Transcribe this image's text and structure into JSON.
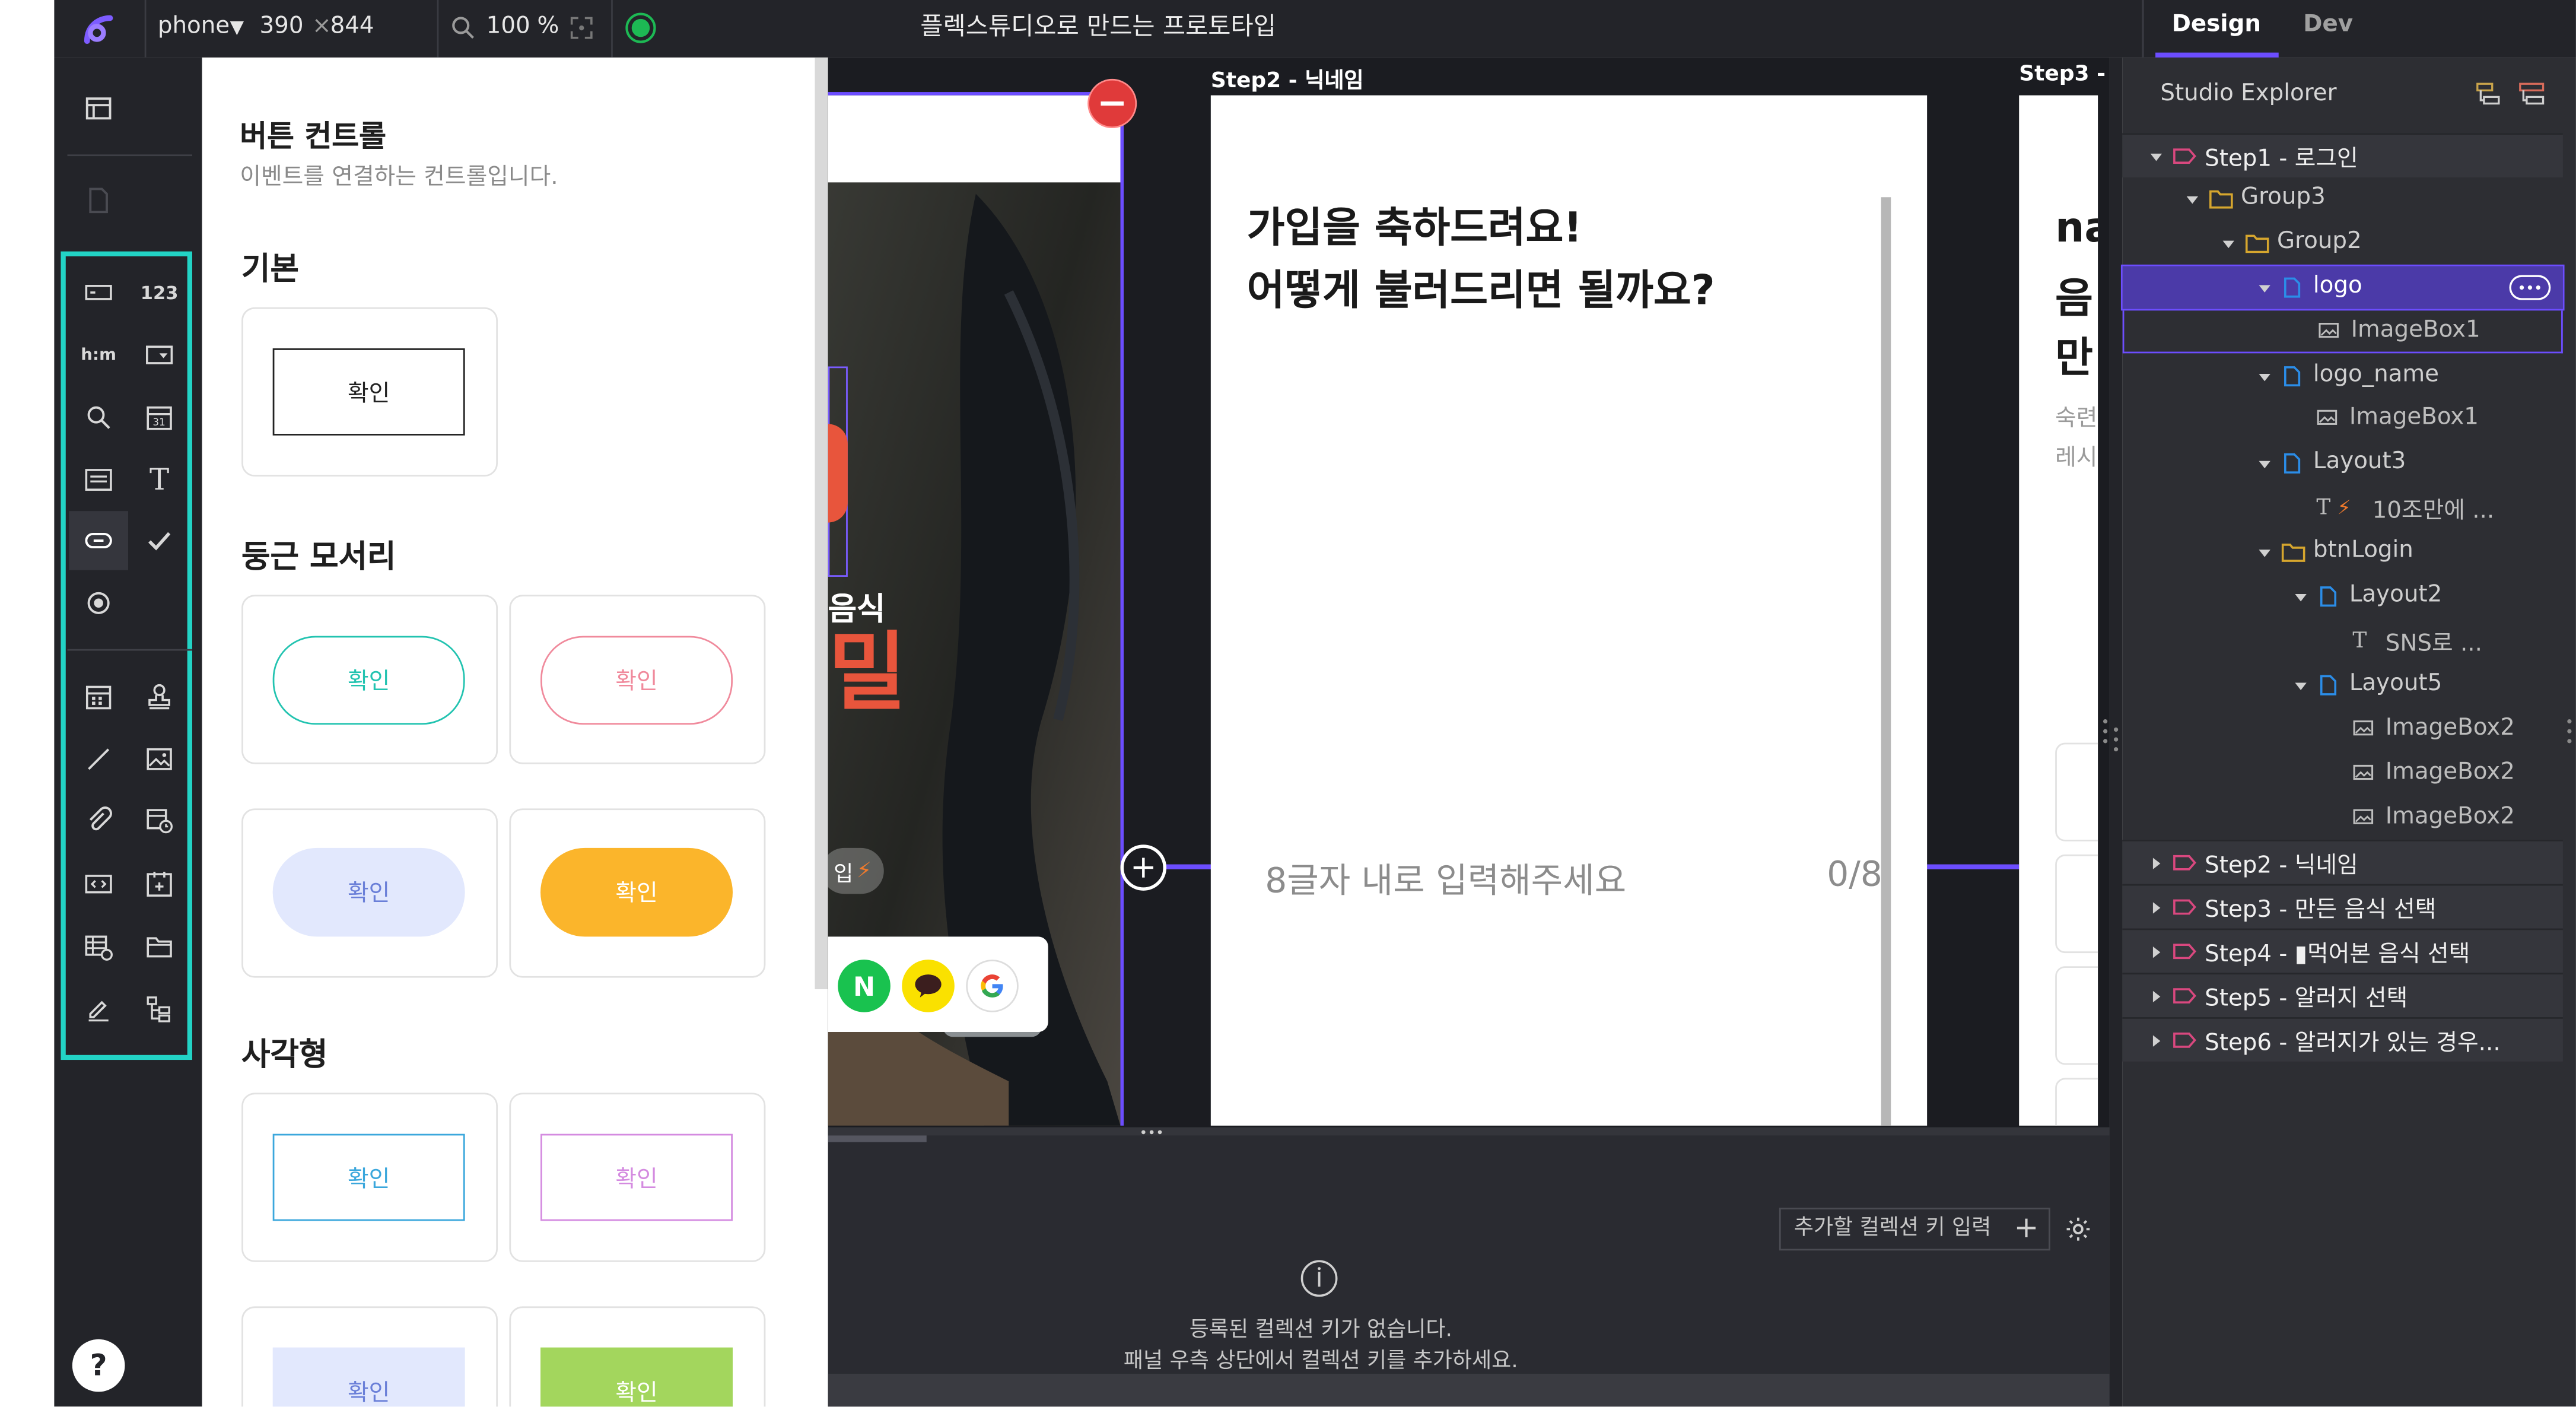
{
  "app": {
    "title": "플렉스튜디오로 만드는 프로토타입",
    "device": "phone",
    "width": "390",
    "times": "×",
    "height": "844",
    "zoom": "100",
    "zoom_unit": "%"
  },
  "right_tabs": {
    "design": "Design",
    "dev": "Dev"
  },
  "panel": {
    "title": "버튼 컨트롤",
    "subtitle": "이벤트를 연결하는 컨트롤입니다.",
    "sections": {
      "basic": "기본",
      "rounded": "둥근 모서리",
      "square": "사각형"
    },
    "button_label": "확인"
  },
  "canvas": {
    "step2_label": "Step2 - 닉네임",
    "step3_label": "Step3 -",
    "step2_heading_1": "가입을 축하드려요!",
    "step2_heading_2": "어떻게 불러드리면 될까요?",
    "step2_placeholder": "8글자 내로 입력해주세요",
    "step2_counter": "0/8",
    "step1_food_text": "음식",
    "step1_big_text": "밀",
    "step1_pill_text": "입",
    "step3_frag_1": "na",
    "step3_frag_2": "음",
    "step3_frag_3": "만",
    "step3_frag_4": "숙련",
    "step3_frag_5": "레시",
    "social": {
      "naver": "N"
    }
  },
  "collection": {
    "key_input_placeholder": "추가할 컬렉션 키 입력",
    "plus": "+",
    "empty_title": "등록된 컬렉션 키가 없습니다.",
    "empty_desc": "패널 우측 상단에서 컬렉션 키를 추가하세요."
  },
  "explorer": {
    "title": "Studio Explorer",
    "tree": [
      {
        "label": "Step1 - 로그인",
        "type": "screen",
        "depth": 0,
        "expanded": true
      },
      {
        "label": "Group3",
        "type": "folder",
        "depth": 1,
        "expanded": true
      },
      {
        "label": "Group2",
        "type": "folder",
        "depth": 2,
        "expanded": true
      },
      {
        "label": "logo",
        "type": "layout",
        "depth": 3,
        "expanded": true,
        "selected": true
      },
      {
        "label": "ImageBox1",
        "type": "image",
        "depth": 4,
        "in_selection": true
      },
      {
        "label": "logo_name",
        "type": "layout",
        "depth": 3,
        "expanded": true
      },
      {
        "label": "ImageBox1",
        "type": "image",
        "depth": 4
      },
      {
        "label": "Layout3",
        "type": "layout",
        "depth": 3,
        "expanded": true
      },
      {
        "label": "10조만에 ...",
        "type": "text-bolt",
        "depth": 4
      },
      {
        "label": "btnLogin",
        "type": "folder",
        "depth": 3,
        "expanded": true
      },
      {
        "label": "Layout2",
        "type": "layout",
        "depth": 4,
        "expanded": true
      },
      {
        "label": "SNS로 ...",
        "type": "text",
        "depth": 5
      },
      {
        "label": "Layout5",
        "type": "layout",
        "depth": 4,
        "expanded": true
      },
      {
        "label": "ImageBox2",
        "type": "image",
        "depth": 5
      },
      {
        "label": "ImageBox2",
        "type": "image",
        "depth": 5
      },
      {
        "label": "ImageBox2",
        "type": "image",
        "depth": 5
      },
      {
        "label": "Step2 - 닉네임",
        "type": "screen",
        "depth": 0,
        "expanded": false
      },
      {
        "label": "Step3 - 만든 음식 선택",
        "type": "screen",
        "depth": 0,
        "expanded": false
      },
      {
        "label": "Step4 - ▮먹어본 음식 선택",
        "type": "screen",
        "depth": 0,
        "expanded": false
      },
      {
        "label": "Step5 - 알러지 선택",
        "type": "screen",
        "depth": 0,
        "expanded": false
      },
      {
        "label": "Step6 - 알러지가 있는 경우...",
        "type": "screen",
        "depth": 0,
        "expanded": false
      }
    ]
  },
  "help": "?",
  "colors": {
    "accent_purple": "#6c4dff",
    "selection_purple": "#4b3aa8",
    "teal": "#22d3c5",
    "status_green": "#1db954",
    "delete_red": "#e03a3a",
    "orange_button": "#fbb52b",
    "green_button": "#a3d65d",
    "lavender_button": "#e2e8fd",
    "dark_bg": "#232429"
  }
}
